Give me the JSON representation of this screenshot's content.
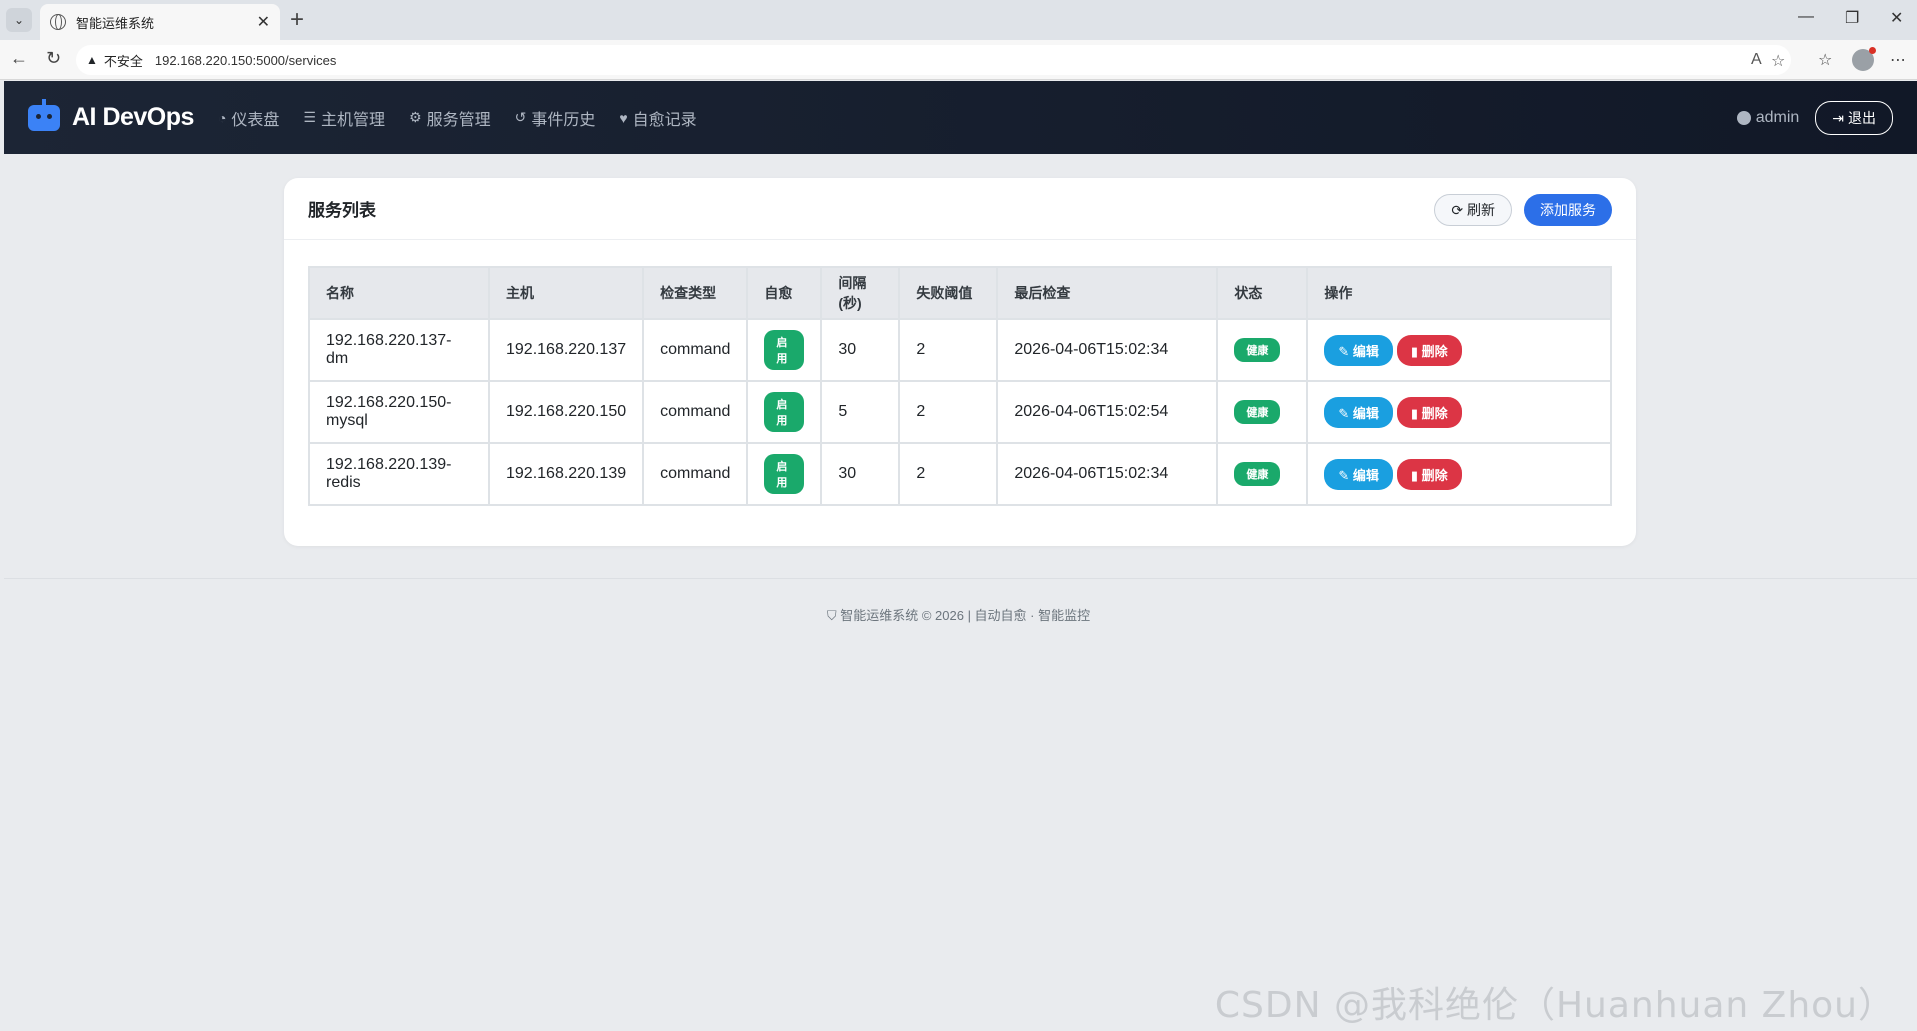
{
  "browser": {
    "tab_title": "智能运维系统",
    "insecure_label": "不安全",
    "url": "192.168.220.150:5000/services"
  },
  "navbar": {
    "brand": "AI DevOps",
    "links": [
      "仪表盘",
      "主机管理",
      "服务管理",
      "事件历史",
      "自愈记录"
    ],
    "user": "admin",
    "logout": "退出"
  },
  "card": {
    "title": "服务列表",
    "refresh_label": "刷新",
    "add_label": "添加服务"
  },
  "table": {
    "headers": [
      "名称",
      "主机",
      "检查类型",
      "自愈",
      "间隔(秒)",
      "失败阈值",
      "最后检查",
      "状态",
      "操作"
    ],
    "rows": [
      {
        "name": "192.168.220.137-dm",
        "host": "192.168.220.137",
        "check_type": "command",
        "self_heal": "启用",
        "interval": "30",
        "threshold": "2",
        "last_check": "2026-04-06T15:02:34",
        "status": "健康",
        "edit": "编辑",
        "delete": "删除"
      },
      {
        "name": "192.168.220.150-mysql",
        "host": "192.168.220.150",
        "check_type": "command",
        "self_heal": "启用",
        "interval": "5",
        "threshold": "2",
        "last_check": "2026-04-06T15:02:54",
        "status": "健康",
        "edit": "编辑",
        "delete": "删除"
      },
      {
        "name": "192.168.220.139-redis",
        "host": "192.168.220.139",
        "check_type": "command",
        "self_heal": "启用",
        "interval": "30",
        "threshold": "2",
        "last_check": "2026-04-06T15:02:34",
        "status": "健康",
        "edit": "编辑",
        "delete": "删除"
      }
    ]
  },
  "footer": "智能运维系统 © 2026 | 自动自愈 · 智能监控",
  "watermark": "CSDN @我科绝伦（Huanhuan Zhou）",
  "colors": {
    "primary": "#2c6fe8",
    "success": "#1aa96b",
    "danger": "#dc3545",
    "info": "#1a9fe0",
    "navbar": "#111827"
  }
}
